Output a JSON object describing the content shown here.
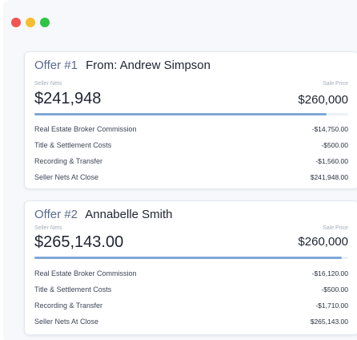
{
  "window": {
    "controls": [
      "close",
      "minimize",
      "maximize"
    ],
    "colors": {
      "close": "#f25353",
      "minimize": "#f6be2c",
      "maximize": "#2ec445"
    }
  },
  "offers": [
    {
      "number_label": "Offer #1",
      "buyer_label": "From: Andrew Simpson",
      "seller_nets_label": "Seller Nets",
      "seller_nets_value": "$241,948",
      "sale_price_label": "Sale Price",
      "sale_price_value": "$260,000",
      "progress_fraction": 0.93,
      "rows": [
        {
          "label": "Real Estate Broker Commission",
          "value": "-$14,750.00"
        },
        {
          "label": "Title & Settlement Costs",
          "value": "-$500.00"
        },
        {
          "label": "Recording & Transfer",
          "value": "-$1,560.00"
        },
        {
          "label": "Seller Nets At Close",
          "value": "$241,948.00"
        }
      ]
    },
    {
      "number_label": "Offer #2",
      "buyer_label": "Annabelle Smith",
      "seller_nets_label": "Seller Nets",
      "seller_nets_value": "$265,143.00",
      "sale_price_label": "Sale Price",
      "sale_price_value": "$260,000",
      "progress_fraction": 0.98,
      "rows": [
        {
          "label": "Real Estate Broker Commission",
          "value": "-$16,120.00"
        },
        {
          "label": "Title & Settlement Costs",
          "value": "-$500.00"
        },
        {
          "label": "Recording & Transfer",
          "value": "-$1,710.00"
        },
        {
          "label": "Seller Nets At Close",
          "value": "$265,143.00"
        }
      ]
    }
  ],
  "colors": {
    "accent_bar": "#7fa7d6",
    "offer_number": "#5a6a8c"
  }
}
